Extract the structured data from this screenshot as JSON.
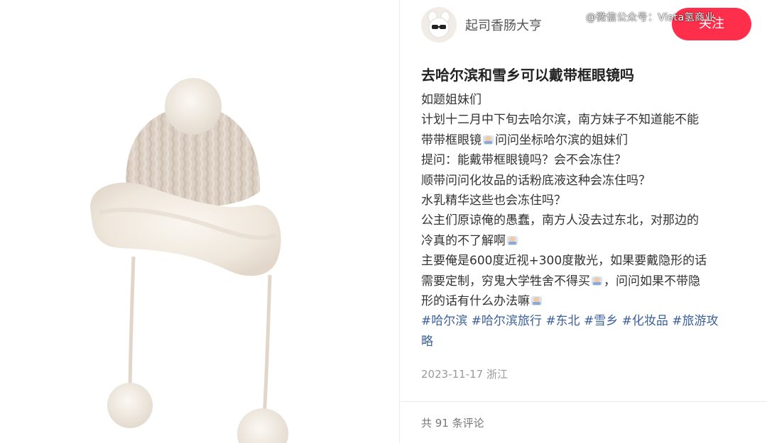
{
  "post": {
    "author": "起司香肠大亨",
    "follow_label": "关注",
    "watermark": "@微信公众号：Vista氢商业",
    "title": "去哈尔滨和雪乡可以戴带框眼镜吗",
    "lines": {
      "l1": "如题姐妹们",
      "l2": "计划十二月中下旬去哈尔滨，南方妹子不知道能不能",
      "l3a": "带带框眼镜",
      "l3b": "问问坐标哈尔滨的姐妹们",
      "l4": "提问：能戴带框眼镜吗？会不会冻住？",
      "l5": "顺带问问化妆品的话粉底液这种会冻住吗？",
      "l6": "水乳精华这些也会冻住吗？",
      "l7": "公主们原谅俺的愚蠢，南方人没去过东北，对那边的",
      "l8": "冷真的不了解啊",
      "l9": "主要俺是600度近视+300度散光，如果要戴隐形的话",
      "l10a": "需要定制，穷鬼大学牲舍不得买",
      "l10b": "，问问如果不带隐",
      "l11": "形的话有什么办法嘛"
    },
    "tags": [
      "#哈尔滨",
      "#哈尔滨旅行",
      "#东北",
      "#雪乡",
      "#化妆品",
      "#旅游攻",
      "略"
    ],
    "date_location": "2023-11-17 浙江",
    "comment_count_text": "共 91 条评论"
  },
  "image": {
    "subject": "knitted-bobble-hat",
    "colors": {
      "knit": "#ddd1c6",
      "fur": "#f3ede4",
      "string": "#e2d6cb"
    }
  },
  "colors": {
    "accent": "#ff2f4b",
    "tag": "#3a5f9a"
  }
}
